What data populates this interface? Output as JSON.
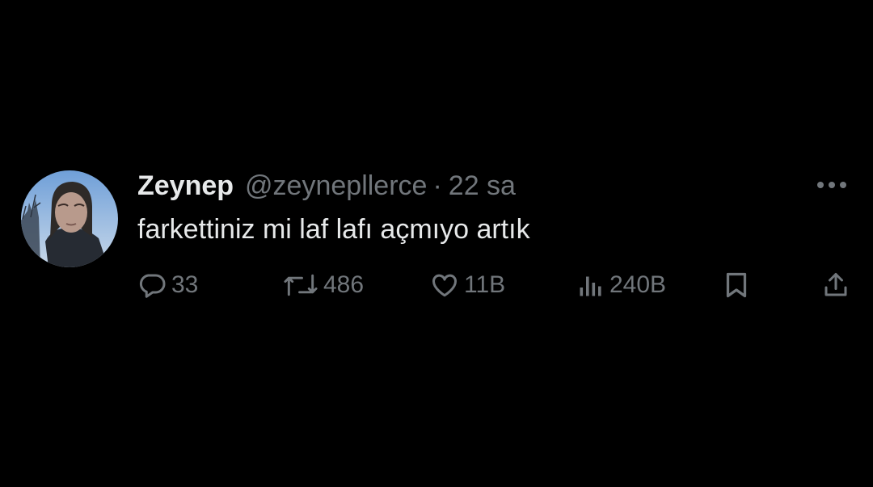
{
  "user": {
    "display_name": "Zeynep",
    "handle": "@zeynepllerce",
    "separator": "·",
    "time": "22 sa"
  },
  "tweet": {
    "text": "farkettiniz mi laf lafı açmıyo artık"
  },
  "actions": {
    "replies": "33",
    "retweets": "486",
    "likes": "11B",
    "views": "240B"
  },
  "icons": {
    "reply": "comment-bubble-icon",
    "retweet": "retweet-icon",
    "like": "heart-icon",
    "views": "bar-chart-icon",
    "bookmark": "bookmark-icon",
    "share": "share-upload-icon",
    "more": "more-dots-icon"
  },
  "colors": {
    "background": "#000000",
    "primary_text": "#e7e9ea",
    "secondary_text": "#71767b"
  }
}
